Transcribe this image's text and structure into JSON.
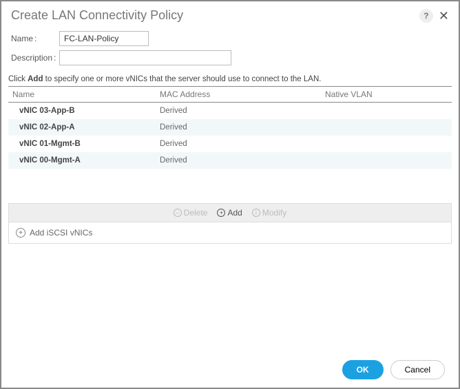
{
  "dialog": {
    "title": "Create LAN Connectivity Policy"
  },
  "form": {
    "name_label": "Name",
    "name_value": "FC-LAN-Policy",
    "desc_label": "Description",
    "desc_value": ""
  },
  "instruction": {
    "prefix": "Click ",
    "bold": "Add",
    "suffix": " to specify one or more vNICs that the server should use to connect to the LAN."
  },
  "table": {
    "headers": {
      "name": "Name",
      "mac": "MAC Address",
      "vlan": "Native VLAN"
    },
    "rows": [
      {
        "name": "vNIC 03-App-B",
        "mac": "Derived",
        "vlan": ""
      },
      {
        "name": "vNIC 02-App-A",
        "mac": "Derived",
        "vlan": ""
      },
      {
        "name": "vNIC 01-Mgmt-B",
        "mac": "Derived",
        "vlan": ""
      },
      {
        "name": "vNIC 00-Mgmt-A",
        "mac": "Derived",
        "vlan": ""
      }
    ]
  },
  "actions": {
    "delete": "Delete",
    "add": "Add",
    "modify": "Modify"
  },
  "iscsi": {
    "label": "Add iSCSI vNICs"
  },
  "footer": {
    "ok": "OK",
    "cancel": "Cancel"
  }
}
